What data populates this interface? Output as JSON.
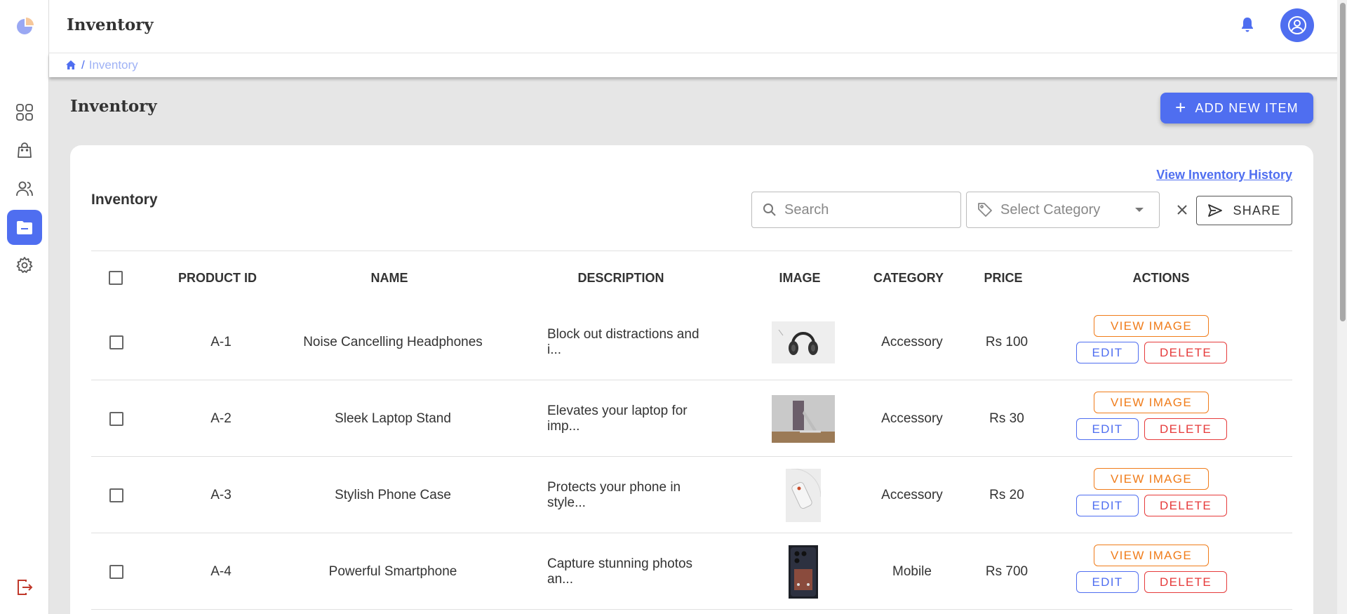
{
  "app": {
    "title": "Inventory"
  },
  "breadcrumb": {
    "current": "Inventory"
  },
  "page": {
    "title": "Inventory",
    "add_button": "ADD NEW ITEM"
  },
  "card": {
    "title": "Inventory",
    "history_link": "View Inventory History",
    "search_placeholder": "Search",
    "category_placeholder": "Select Category",
    "share_label": "SHARE"
  },
  "table": {
    "columns": [
      "PRODUCT ID",
      "NAME",
      "DESCRIPTION",
      "IMAGE",
      "CATEGORY",
      "PRICE",
      "ACTIONS"
    ],
    "rows": [
      {
        "id": "A-1",
        "name": "Noise Cancelling Headphones",
        "description": "Block out distractions and i...",
        "category": "Accessory",
        "price": "Rs 100"
      },
      {
        "id": "A-2",
        "name": "Sleek Laptop Stand",
        "description": "Elevates your laptop for imp...",
        "category": "Accessory",
        "price": "Rs 30"
      },
      {
        "id": "A-3",
        "name": "Stylish Phone Case",
        "description": "Protects your phone in style...",
        "category": "Accessory",
        "price": "Rs 20"
      },
      {
        "id": "A-4",
        "name": "Powerful Smartphone",
        "description": "Capture stunning photos an...",
        "category": "Mobile",
        "price": "Rs 700"
      }
    ],
    "actions": {
      "view": "VIEW IMAGE",
      "edit": "EDIT",
      "delete": "DELETE"
    }
  },
  "icons": {
    "sidebar": [
      "dashboard-icon",
      "shopping-bag-icon",
      "users-icon",
      "inventory-folder-icon",
      "settings-icon"
    ],
    "logout": "logout-icon",
    "header": [
      "bell-icon",
      "account-icon"
    ]
  },
  "colors": {
    "primary": "#4f6ef0",
    "view": "#f07c1a",
    "delete": "#e63b3b",
    "logout": "#c0392b",
    "background": "#e6e6e6"
  }
}
